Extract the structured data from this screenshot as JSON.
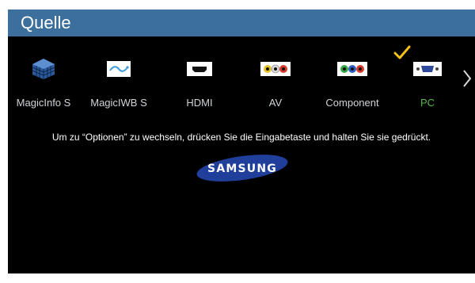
{
  "header": {
    "title": "Quelle"
  },
  "sources": [
    {
      "label": "MagicInfo S",
      "icon": "magicinfo-icon",
      "selected": false
    },
    {
      "label": "MagicIWB S",
      "icon": "magiciwb-icon",
      "selected": false
    },
    {
      "label": "HDMI",
      "icon": "hdmi-port-icon",
      "selected": false
    },
    {
      "label": "AV",
      "icon": "av-ports-icon",
      "selected": false
    },
    {
      "label": "Component",
      "icon": "component-ports-icon",
      "selected": false
    },
    {
      "label": "PC",
      "icon": "pc-vga-port-icon",
      "selected": true
    }
  ],
  "hint": {
    "text": "Um zu “Optionen” zu wechseln, drücken Sie die Eingabetaste und halten Sie sie gedrückt."
  },
  "logo": {
    "text": "SAMSUNG"
  },
  "colors": {
    "title_bar": "#3c6f9c",
    "background": "#000000",
    "selected_label": "#56b848",
    "check_mark": "#f2c21b",
    "logo_blue": "#1f3f9b"
  }
}
